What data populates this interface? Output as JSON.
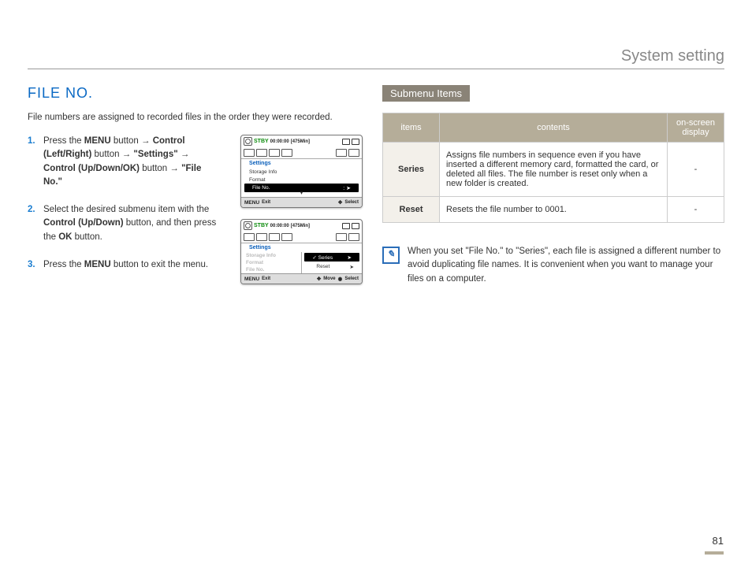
{
  "header": {
    "section": "System setting"
  },
  "title": "FILE NO.",
  "intro": "File numbers are assigned to recorded files in the order they were recorded.",
  "steps": [
    {
      "num": "1.",
      "html": "Press the <b>MENU</b> button → <b>Control (Left/Right)</b> button → <b>\"Settings\"</b> → <b>Control (Up/Down/OK)</b> button → <b>\"File No.\"</b>"
    },
    {
      "num": "2.",
      "html": "Select the desired submenu item with the <b>Control (Up/Down)</b> button, and then press the <b>OK</b> button."
    },
    {
      "num": "3.",
      "html": "Press the <b>MENU</b> button to exit the menu."
    }
  ],
  "shot1": {
    "stby": "STBY",
    "time": "00:00:00",
    "remain": "[475Min]",
    "settings": "Settings",
    "items": [
      "Storage Info",
      "Format",
      "File No."
    ],
    "hi_suffix": ": ➤",
    "foot_menu": "MENU",
    "foot_exit": "Exit",
    "foot_select": "Select"
  },
  "shot2": {
    "stby": "STBY",
    "time": "00:00:00",
    "remain": "[475Min]",
    "settings": "Settings",
    "left": [
      "Storage Info",
      "Format",
      "File No."
    ],
    "right_hi": "Series",
    "right_hi_mark": "✓",
    "right": "Reset",
    "foot_menu": "MENU",
    "foot_exit": "Exit",
    "foot_move": "Move",
    "foot_select": "Select"
  },
  "submenu_title": "Submenu Items",
  "table": {
    "headers": {
      "items": "items",
      "contents": "contents",
      "osd": "on-screen display"
    },
    "rows": [
      {
        "item": "Series",
        "content": "Assigns file numbers in sequence even if you have inserted a different memory card, formatted the card, or deleted all files. The file number is reset only when a new folder is created.",
        "osd": "-"
      },
      {
        "item": "Reset",
        "content": "Resets the file number to 0001.",
        "osd": "-"
      }
    ]
  },
  "note": "When you set \"File No.\" to \"Series\", each file is assigned a different number to avoid duplicating file names. It is convenient when you want to manage your files on a computer.",
  "page_num": "81"
}
